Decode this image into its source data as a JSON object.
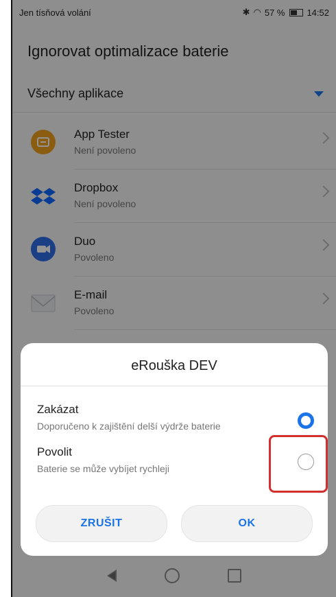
{
  "status_bar": {
    "left_text": "Jen tísňová volání",
    "battery_percent": "57 %",
    "time": "14:52"
  },
  "header": {
    "title": "Ignorovat optimalizace baterie"
  },
  "filter": {
    "label": "Všechny aplikace"
  },
  "apps": [
    {
      "name": "App Tester",
      "status": "Není povoleno",
      "icon": "app-tester-icon",
      "color": "#f0a01e"
    },
    {
      "name": "Dropbox",
      "status": "Není povoleno",
      "icon": "dropbox-icon",
      "color": "#0d66ff"
    },
    {
      "name": "Duo",
      "status": "Povoleno",
      "icon": "duo-icon",
      "color": "#2d6de6"
    },
    {
      "name": "E-mail",
      "status": "Povoleno",
      "icon": "email-icon",
      "color": "#cfd3d8"
    }
  ],
  "dialog": {
    "title": "eRouška DEV",
    "options": [
      {
        "title": "Zakázat",
        "subtitle": "Doporučeno k zajištění delší výdrže baterie",
        "selected": true
      },
      {
        "title": "Povolit",
        "subtitle": "Baterie se může vybíjet rychleji",
        "selected": false
      }
    ],
    "cancel_label": "ZRUŠIT",
    "ok_label": "OK"
  },
  "colors": {
    "accent": "#1a73e8",
    "highlight": "#d32f2f"
  }
}
